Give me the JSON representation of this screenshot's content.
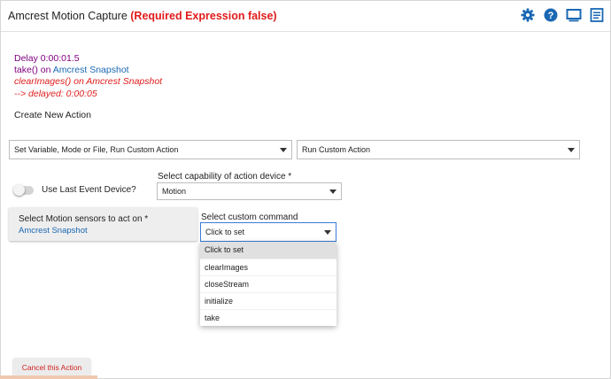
{
  "header": {
    "title": "Amcrest Motion Capture",
    "status": "(Required Expression false)",
    "icons": [
      "gear-icon",
      "help-icon",
      "monitor-icon",
      "notes-icon"
    ],
    "accent": "#1a67b3"
  },
  "actions_list": {
    "line1": "Delay 0:00:01.5",
    "line2_prefix": "take() on ",
    "line2_device": "Amcrest Snapshot",
    "line3": "clearImages() on Amcrest Snapshot",
    "line4": " --> delayed: 0:00:05"
  },
  "create_label": "Create New Action",
  "action_type_select": {
    "value": "Set Variable, Mode or File, Run Custom Action"
  },
  "action_select": {
    "value": "Run Custom Action"
  },
  "capability": {
    "label": "Select capability of action device *",
    "value": "Motion"
  },
  "last_event_toggle": {
    "label": "Use Last Event Device?",
    "checked": false
  },
  "sensor_card": {
    "label": "Select Motion sensors to act on *",
    "value": "Amcrest Snapshot"
  },
  "custom_command": {
    "label": "Select custom command",
    "value": "Click to set",
    "options": [
      "Click to set",
      "clearImages",
      "closeStream",
      "initialize",
      "take"
    ]
  },
  "cancel_label": "Cancel this Action"
}
